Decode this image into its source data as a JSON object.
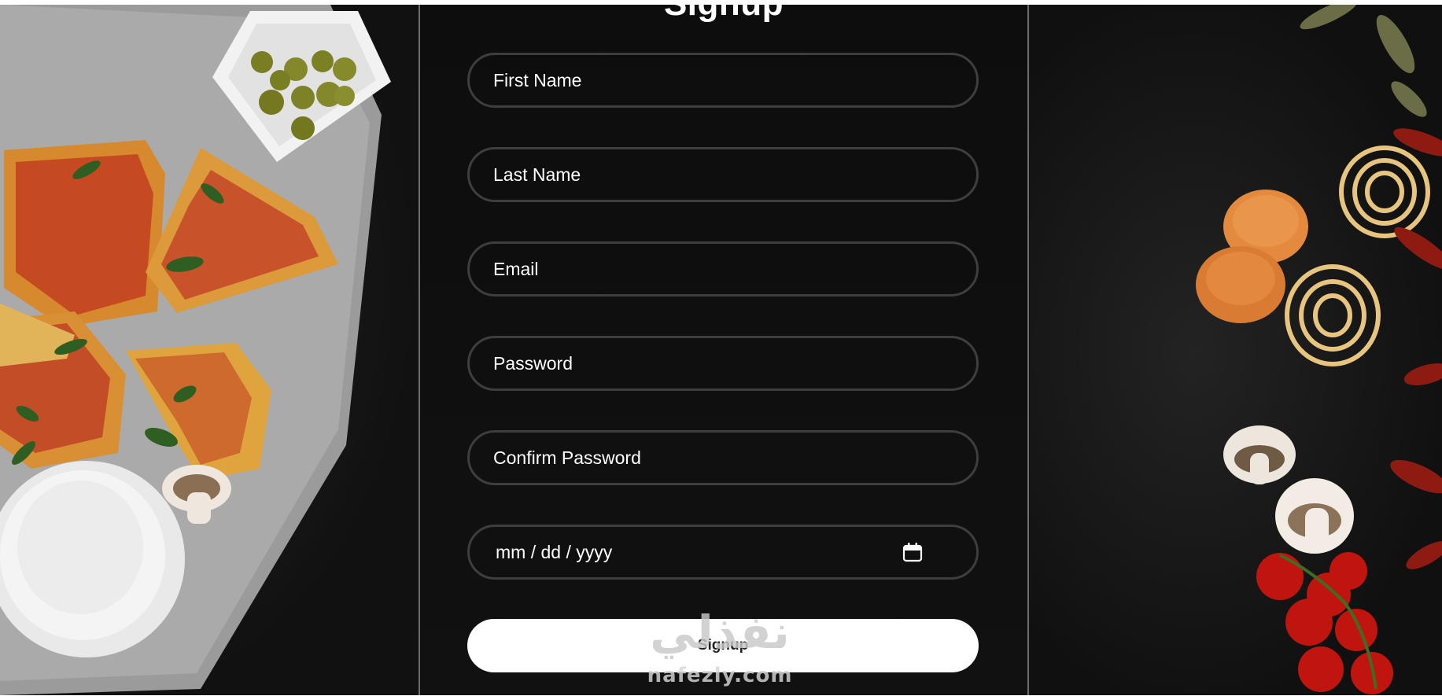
{
  "form": {
    "title": "Signup",
    "fields": [
      {
        "placeholder": "First Name",
        "value": ""
      },
      {
        "placeholder": "Last Name",
        "value": ""
      },
      {
        "placeholder": "Email",
        "value": ""
      },
      {
        "placeholder": "Password",
        "value": ""
      },
      {
        "placeholder": "Confirm Password",
        "value": ""
      }
    ],
    "date_field": {
      "placeholder": "mm / dd / yyyy",
      "icon": "calendar-icon"
    },
    "submit_label": "Signup"
  },
  "watermark": {
    "arabic": "نفذلي",
    "latin": "nafezly.com"
  },
  "colors": {
    "background": "#141414",
    "panel_border": "#6e6e6e",
    "field_border": "#3e3e3e",
    "text": "#ffffff",
    "button_bg": "#ffffff"
  }
}
